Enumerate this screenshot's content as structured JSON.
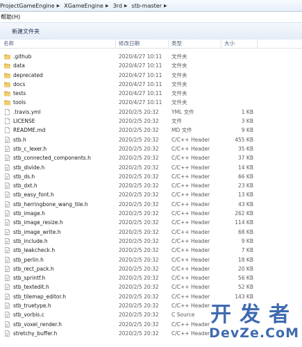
{
  "address": {
    "crumbs": [
      "ProjectGameEngine",
      "XGameEngine",
      "3rd",
      "stb-master"
    ]
  },
  "menu": {
    "help": "帮助(H)"
  },
  "toolbar": {
    "new_folder": "新建文件夹"
  },
  "columns": {
    "name": "名称",
    "date": "修改日期",
    "type": "类型",
    "size": "大小"
  },
  "files": [
    {
      "name": ".github",
      "date": "2020/4/27 10:11",
      "type": "文件夹",
      "size": "",
      "icon": "folder-icon"
    },
    {
      "name": "data",
      "date": "2020/4/27 10:11",
      "type": "文件夹",
      "size": "",
      "icon": "folder-icon"
    },
    {
      "name": "deprecated",
      "date": "2020/4/27 10:11",
      "type": "文件夹",
      "size": "",
      "icon": "folder-icon"
    },
    {
      "name": "docs",
      "date": "2020/4/27 10:11",
      "type": "文件夹",
      "size": "",
      "icon": "folder-icon"
    },
    {
      "name": "tests",
      "date": "2020/4/27 10:11",
      "type": "文件夹",
      "size": "",
      "icon": "folder-icon"
    },
    {
      "name": "tools",
      "date": "2020/4/27 10:11",
      "type": "文件夹",
      "size": "",
      "icon": "folder-icon"
    },
    {
      "name": ".travis.yml",
      "date": "2020/2/5 20:32",
      "type": "YML 文件",
      "size": "1 KB",
      "icon": "file-icon"
    },
    {
      "name": "LICENSE",
      "date": "2020/2/5 20:32",
      "type": "文件",
      "size": "3 KB",
      "icon": "file-icon"
    },
    {
      "name": "README.md",
      "date": "2020/2/5 20:32",
      "type": "MD 文件",
      "size": "9 KB",
      "icon": "file-icon"
    },
    {
      "name": "stb.h",
      "date": "2020/2/5 20:32",
      "type": "C/C++ Header",
      "size": "455 KB",
      "icon": "header-file-icon"
    },
    {
      "name": "stb_c_lexer.h",
      "date": "2020/2/5 20:32",
      "type": "C/C++ Header",
      "size": "35 KB",
      "icon": "header-file-icon"
    },
    {
      "name": "stb_connected_components.h",
      "date": "2020/2/5 20:32",
      "type": "C/C++ Header",
      "size": "37 KB",
      "icon": "header-file-icon"
    },
    {
      "name": "stb_divide.h",
      "date": "2020/2/5 20:32",
      "type": "C/C++ Header",
      "size": "14 KB",
      "icon": "header-file-icon"
    },
    {
      "name": "stb_ds.h",
      "date": "2020/2/5 20:32",
      "type": "C/C++ Header",
      "size": "66 KB",
      "icon": "header-file-icon"
    },
    {
      "name": "stb_dxt.h",
      "date": "2020/2/5 20:32",
      "type": "C/C++ Header",
      "size": "23 KB",
      "icon": "header-file-icon"
    },
    {
      "name": "stb_easy_font.h",
      "date": "2020/2/5 20:32",
      "type": "C/C++ Header",
      "size": "13 KB",
      "icon": "header-file-icon"
    },
    {
      "name": "stb_herringbone_wang_tile.h",
      "date": "2020/2/5 20:32",
      "type": "C/C++ Header",
      "size": "43 KB",
      "icon": "header-file-icon"
    },
    {
      "name": "stb_image.h",
      "date": "2020/2/5 20:32",
      "type": "C/C++ Header",
      "size": "262 KB",
      "icon": "header-file-icon"
    },
    {
      "name": "stb_image_resize.h",
      "date": "2020/2/5 20:32",
      "type": "C/C++ Header",
      "size": "114 KB",
      "icon": "header-file-icon"
    },
    {
      "name": "stb_image_write.h",
      "date": "2020/2/5 20:32",
      "type": "C/C++ Header",
      "size": "68 KB",
      "icon": "header-file-icon"
    },
    {
      "name": "stb_include.h",
      "date": "2020/2/5 20:32",
      "type": "C/C++ Header",
      "size": "9 KB",
      "icon": "header-file-icon"
    },
    {
      "name": "stb_leakcheck.h",
      "date": "2020/2/5 20:32",
      "type": "C/C++ Header",
      "size": "7 KB",
      "icon": "header-file-icon"
    },
    {
      "name": "stb_perlin.h",
      "date": "2020/2/5 20:32",
      "type": "C/C++ Header",
      "size": "18 KB",
      "icon": "header-file-icon"
    },
    {
      "name": "stb_rect_pack.h",
      "date": "2020/2/5 20:32",
      "type": "C/C++ Header",
      "size": "20 KB",
      "icon": "header-file-icon"
    },
    {
      "name": "stb_sprintf.h",
      "date": "2020/2/5 20:32",
      "type": "C/C++ Header",
      "size": "56 KB",
      "icon": "header-file-icon"
    },
    {
      "name": "stb_textedit.h",
      "date": "2020/2/5 20:32",
      "type": "C/C++ Header",
      "size": "52 KB",
      "icon": "header-file-icon"
    },
    {
      "name": "stb_tilemap_editor.h",
      "date": "2020/2/5 20:32",
      "type": "C/C++ Header",
      "size": "143 KB",
      "icon": "header-file-icon"
    },
    {
      "name": "stb_truetype.h",
      "date": "2020/2/5 20:32",
      "type": "C/C++ Header",
      "size": "",
      "icon": "header-file-icon"
    },
    {
      "name": "stb_vorbis.c",
      "date": "2020/2/5 20:32",
      "type": "C Source",
      "size": "",
      "icon": "source-file-icon"
    },
    {
      "name": "stb_voxel_render.h",
      "date": "2020/2/5 20:32",
      "type": "C/C++ Header",
      "size": "",
      "icon": "header-file-icon"
    },
    {
      "name": "stretchy_buffer.h",
      "date": "2020/2/5 20:32",
      "type": "C/C++ Header",
      "size": "",
      "icon": "header-file-icon"
    }
  ],
  "watermark": {
    "top": "开发者",
    "bottom": "DevZe.CoM"
  },
  "colors": {
    "folder": "#e8b84a",
    "toolbar": "#e3ecf7",
    "header_text": "#4c607a"
  }
}
